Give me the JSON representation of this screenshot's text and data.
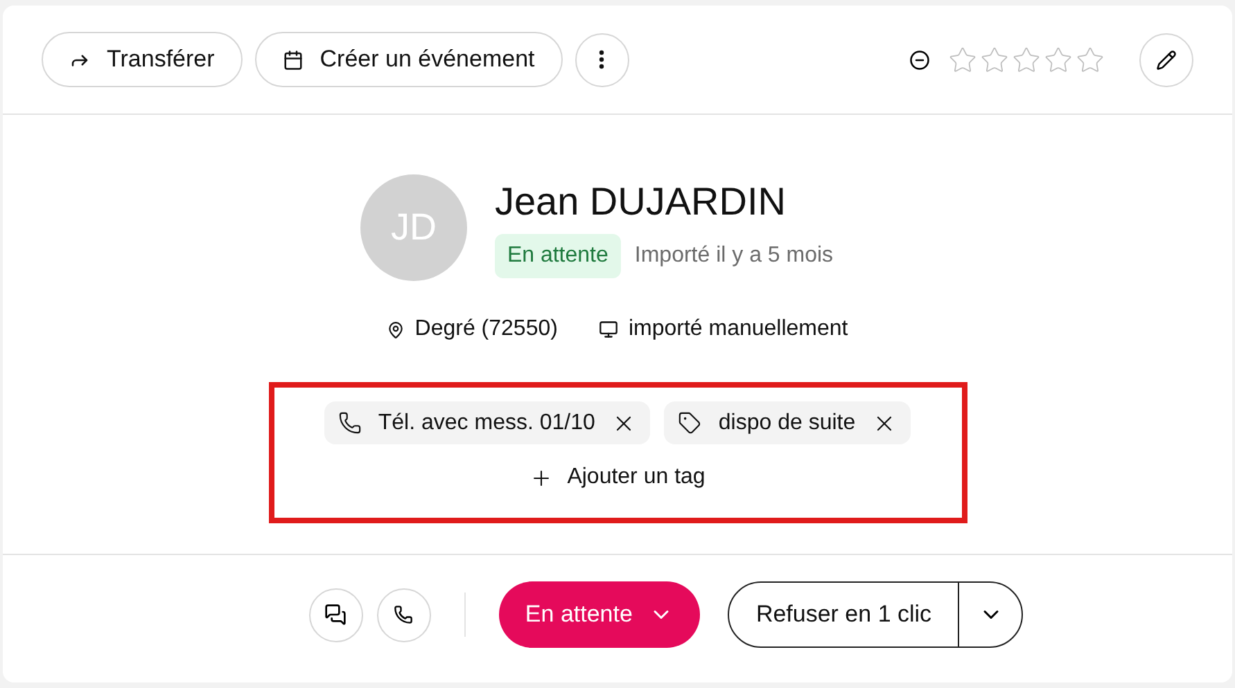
{
  "toolbar": {
    "buttons": [
      {
        "label": "Transférer",
        "kind": "forward"
      },
      {
        "label": "Créer un événement",
        "kind": "calendar"
      }
    ],
    "stars": 0
  },
  "contact": {
    "initials": "JD",
    "name": "Jean DUJARDIN",
    "status": "En attente",
    "imported": "Importé il y a 5 mois",
    "location": "Degré (72550)",
    "source": "importé manuellement"
  },
  "tags": [
    {
      "label": "Tél. avec mess. 01/10",
      "kind": "phone"
    },
    {
      "label": "dispo de suite",
      "kind": "tag"
    }
  ],
  "add_tag": "Ajouter un tag",
  "footer": {
    "status_button": "En attente",
    "refuse_button": "Refuser en 1 clic"
  }
}
